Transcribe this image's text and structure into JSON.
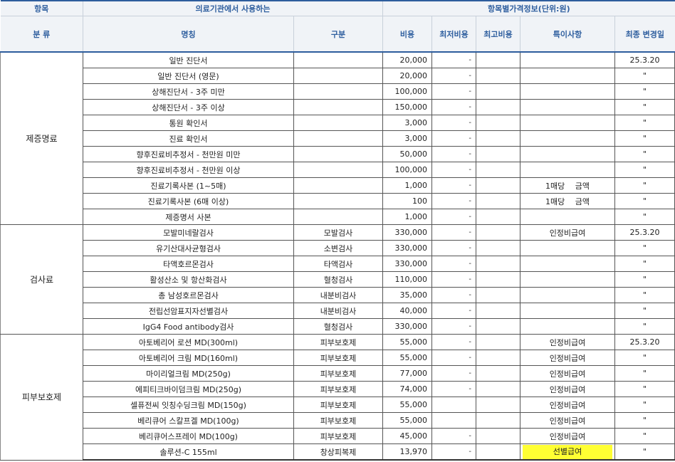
{
  "header": {
    "row1": [
      "항목",
      "의료기관에서 사용하는",
      "항목별가격정보(단위:원)"
    ],
    "row2": [
      "분 류",
      "명칭",
      "구분",
      "비용",
      "최저비용",
      "최고비용",
      "특이사항",
      "최종 변경일"
    ]
  },
  "groups": [
    {
      "category": "제증명료",
      "rows": [
        {
          "name": "일반 진단서",
          "sub": "",
          "cost": "20,000",
          "min": "-",
          "max": "",
          "note": "",
          "date": "25.3.20"
        },
        {
          "name": "일반 진단서 (영문)",
          "sub": "",
          "cost": "20,000",
          "min": "-",
          "max": "",
          "note": "",
          "date": "\""
        },
        {
          "name": "상해진단서 - 3주 미만",
          "sub": "",
          "cost": "100,000",
          "min": "-",
          "max": "",
          "note": "",
          "date": "\""
        },
        {
          "name": "상해진단서 - 3주 이상",
          "sub": "",
          "cost": "150,000",
          "min": "-",
          "max": "",
          "note": "",
          "date": "\""
        },
        {
          "name": "통원 확인서",
          "sub": "",
          "cost": "3,000",
          "min": "-",
          "max": "",
          "note": "",
          "date": "\""
        },
        {
          "name": "진료 확인서",
          "sub": "",
          "cost": "3,000",
          "min": "-",
          "max": "",
          "note": "",
          "date": "\""
        },
        {
          "name": "향후진료비추정서 - 천만원 미만",
          "sub": "",
          "cost": "50,000",
          "min": "-",
          "max": "",
          "note": "",
          "date": "\""
        },
        {
          "name": "향후진료비추정서 - 천만원 이상",
          "sub": "",
          "cost": "100,000",
          "min": "-",
          "max": "",
          "note": "",
          "date": "\""
        },
        {
          "name": "진료기록사본 (1~5매)",
          "sub": "",
          "cost": "1,000",
          "min": "-",
          "max": "",
          "note": "1매당　 금액",
          "date": "\""
        },
        {
          "name": "진료기록사본 (6매 이상)",
          "sub": "",
          "cost": "100",
          "min": "-",
          "max": "",
          "note": "1매당　 금액",
          "date": "\""
        },
        {
          "name": "제증명서 사본",
          "sub": "",
          "cost": "1,000",
          "min": "-",
          "max": "",
          "note": "",
          "date": "\""
        }
      ]
    },
    {
      "category": "검사료",
      "rows": [
        {
          "name": "모발미네랄검사",
          "sub": "모발검사",
          "cost": "330,000",
          "min": "-",
          "max": "",
          "note": "인정비급여",
          "date": "25.3.20"
        },
        {
          "name": "유기산대사균형검사",
          "sub": "소변검사",
          "cost": "330,000",
          "min": "-",
          "max": "",
          "note": "",
          "date": "\""
        },
        {
          "name": "타액호르몬검사",
          "sub": "타액검사",
          "cost": "330,000",
          "min": "-",
          "max": "",
          "note": "",
          "date": "\""
        },
        {
          "name": "활성산소 및 항산화검사",
          "sub": "혈청검사",
          "cost": "110,000",
          "min": "-",
          "max": "",
          "note": "",
          "date": "\""
        },
        {
          "name": "총 남성호르몬검사",
          "sub": "내분비검사",
          "cost": "35,000",
          "min": "-",
          "max": "",
          "note": "",
          "date": "\""
        },
        {
          "name": "전립선암표지자선별검사",
          "sub": "내분비검사",
          "cost": "40,000",
          "min": "-",
          "max": "",
          "note": "",
          "date": "\""
        },
        {
          "name": "IgG4 Food antibody검사",
          "sub": "혈청검사",
          "cost": "330,000",
          "min": "-",
          "max": "",
          "note": "",
          "date": "\""
        }
      ]
    },
    {
      "category": "피부보호제",
      "rows": [
        {
          "name": "아토베리어 로션 MD(300ml)",
          "sub": "피부보호제",
          "cost": "55,000",
          "min": "-",
          "max": "",
          "note": "인정비급여",
          "date": "25.3.20"
        },
        {
          "name": "아토베리어 크림 MD(160ml)",
          "sub": "피부보호제",
          "cost": "55,000",
          "min": "-",
          "max": "",
          "note": "인정비급여",
          "date": "\""
        },
        {
          "name": "마이리얼크림 MD(250g)",
          "sub": "피부보호제",
          "cost": "77,000",
          "min": "-",
          "max": "",
          "note": "인정비급여",
          "date": "\""
        },
        {
          "name": "에피티크바이덤크림 MD(250g)",
          "sub": "피부보호제",
          "cost": "74,000",
          "min": "-",
          "max": "",
          "note": "인정비급여",
          "date": "\""
        },
        {
          "name": "셀퓨전씨 잇칭수딩크림 MD(150g)",
          "sub": "피부보호제",
          "cost": "55,000",
          "min": "",
          "max": "",
          "note": "인정비급여",
          "date": "\""
        },
        {
          "name": "베리큐어 스칼프겔 MD(100g)",
          "sub": "피부보호제",
          "cost": "55,000",
          "min": "",
          "max": "",
          "note": "인정비급여",
          "date": "\""
        },
        {
          "name": "베리큐어스프레이 MD(100g)",
          "sub": "피부보호제",
          "cost": "45,000",
          "min": "-",
          "max": "",
          "note": "인정비급여",
          "date": "\""
        },
        {
          "name": "솔루션-C 155ml",
          "sub": "창상피복제",
          "cost": "13,970",
          "min": "-",
          "max": "",
          "note": "선별급여",
          "date": "\"",
          "highlight": true
        }
      ]
    }
  ],
  "colors": {
    "header_text": "#2f5f9f",
    "header_bg": "#f0f3f7",
    "highlight": "#ffff33"
  }
}
